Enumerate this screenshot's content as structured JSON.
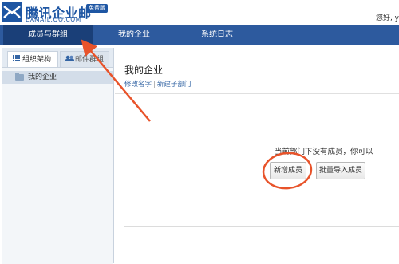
{
  "header": {
    "brand": "腾讯企业邮",
    "badge": "免费版",
    "domain": "EXMAIL.QQ.COM",
    "greeting": "您好, y"
  },
  "nav": {
    "items": [
      {
        "label": "成员与群组",
        "active": true
      },
      {
        "label": "我的企业",
        "active": false
      },
      {
        "label": "系统日志",
        "active": false
      }
    ]
  },
  "sidebar": {
    "tabs": [
      {
        "label": "组织架构",
        "icon": "list-icon"
      },
      {
        "label": "邮件群组",
        "icon": "group-icon"
      }
    ],
    "tree": [
      {
        "label": "我的企业",
        "icon": "folder-icon"
      }
    ]
  },
  "main": {
    "title": "我的企业",
    "links": [
      "修改名字",
      "新建子部门"
    ],
    "empty_message": "当前部门下没有成员，你可以",
    "add_button": "新增成员",
    "import_button": "批量导入成员"
  },
  "colors": {
    "nav_bg": "#2d5a9e",
    "nav_active": "#1a3f78",
    "brand": "#1e56a3",
    "annotation": "#e8532a"
  }
}
